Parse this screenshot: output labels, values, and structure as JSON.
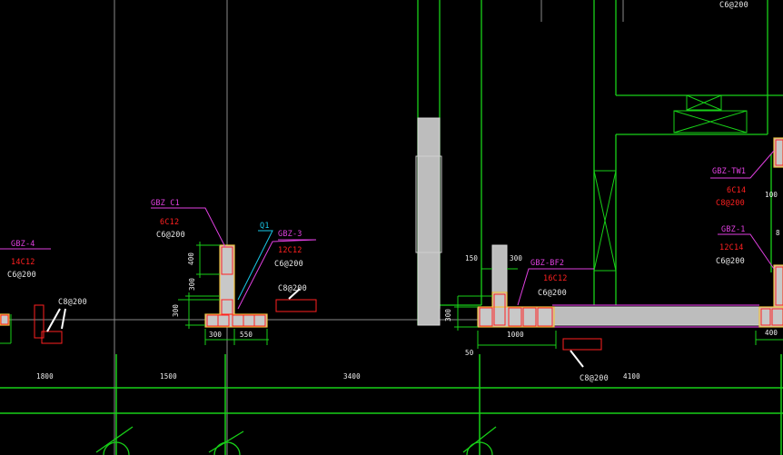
{
  "drawing": {
    "top_right_label": "C6@200",
    "labels": {
      "gbz4_name": "GBZ-4",
      "gbz4_bars": "14C12",
      "gbz4_stirrup": "C6@200",
      "left_tie": "C8@200",
      "gbzc1_name": "GBZ C1",
      "gbzc1_bars": "6C12",
      "gbzc1_stirrup": "C6@200",
      "q1": "Q1",
      "gbz3_name": "GBZ-3",
      "gbz3_bars": "12C12",
      "gbz3_stirrup": "C6@200",
      "mid_tie": "C8@200",
      "gbzbf2_name": "GBZ-BF2",
      "gbzbf2_bars": "16C12",
      "gbzbf2_stirrup": "C6@200",
      "bottom_tie": "C8@200",
      "gbztw1_name": "GBZ-TW1",
      "gbztw1_bars": "6C14",
      "gbztw1_stirrup": "C8@200",
      "gbz1_name": "GBZ-1",
      "gbz1_bars": "12C14",
      "gbz1_stirrup": "C6@200"
    },
    "dims": {
      "d400": "400",
      "d300a": "300",
      "d300b": "300",
      "d300c": "300",
      "d550": "550",
      "d150": "150",
      "d300d": "300",
      "d300e": "300",
      "d1000": "1000",
      "d50": "50",
      "d400r": "400",
      "d100r": "100",
      "d8r": "8"
    },
    "axis_spacings": [
      "1800",
      "1500",
      "3400",
      "4100"
    ]
  },
  "colors": {
    "background": "#000000",
    "wall_green": "#18d018",
    "rebar_magenta": "#e040e0",
    "rebar_red": "#ff2020",
    "column_fill": "#c8c8c8",
    "column_edge": "#f0c040",
    "grid_line": "#8a8a8a"
  }
}
